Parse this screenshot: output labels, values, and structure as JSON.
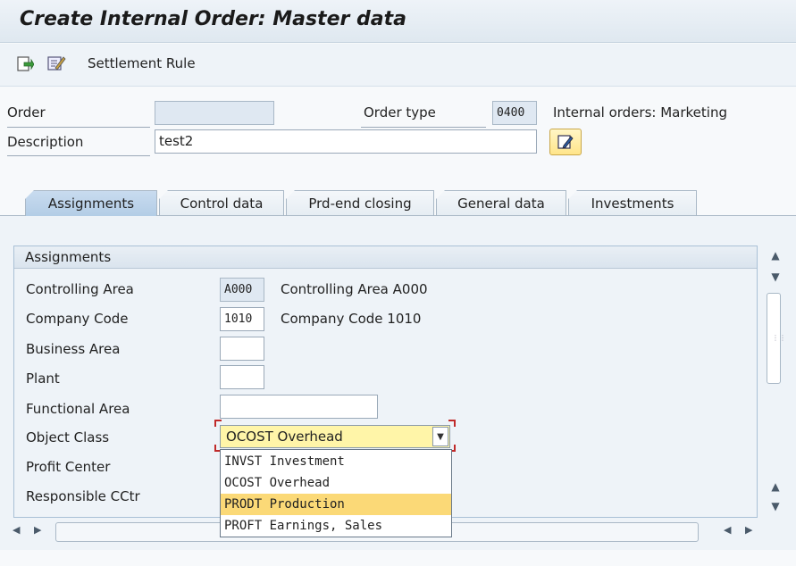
{
  "window": {
    "title": "Create Internal Order: Master data"
  },
  "toolbar": {
    "settlement_rule_label": "Settlement Rule"
  },
  "header": {
    "order_label": "Order",
    "order_value": "",
    "order_type_label": "Order type",
    "order_type_value": "0400",
    "order_type_text": "Internal orders: Marketing",
    "description_label": "Description",
    "description_value": "test2"
  },
  "tabs": [
    {
      "label": "Assignments"
    },
    {
      "label": "Control data"
    },
    {
      "label": "Prd-end closing"
    },
    {
      "label": "General data"
    },
    {
      "label": "Investments"
    }
  ],
  "assignments": {
    "group_title": "Assignments",
    "controlling_area_label": "Controlling Area",
    "controlling_area_value": "A000",
    "controlling_area_text": "Controlling Area A000",
    "company_code_label": "Company Code",
    "company_code_value": "1010",
    "company_code_text": "Company Code 1010",
    "business_area_label": "Business Area",
    "plant_label": "Plant",
    "functional_area_label": "Functional Area",
    "object_class_label": "Object Class",
    "object_class_value": "OCOST Overhead",
    "profit_center_label": "Profit Center",
    "responsible_cctr_label": "Responsible CCtr"
  },
  "object_class_options": [
    {
      "label": "INVST  Investment"
    },
    {
      "label": "OCOST  Overhead"
    },
    {
      "label": "PRODT  Production",
      "highlighted": true
    },
    {
      "label": "PROFT  Earnings, Sales"
    }
  ],
  "colors": {
    "title_bg": "#dfe8f0",
    "active_tab": "#b3cde6",
    "dropdown_field": "#fff5a8",
    "dropdown_highlight": "#fbd977",
    "focus_corner": "#c02a2a"
  }
}
